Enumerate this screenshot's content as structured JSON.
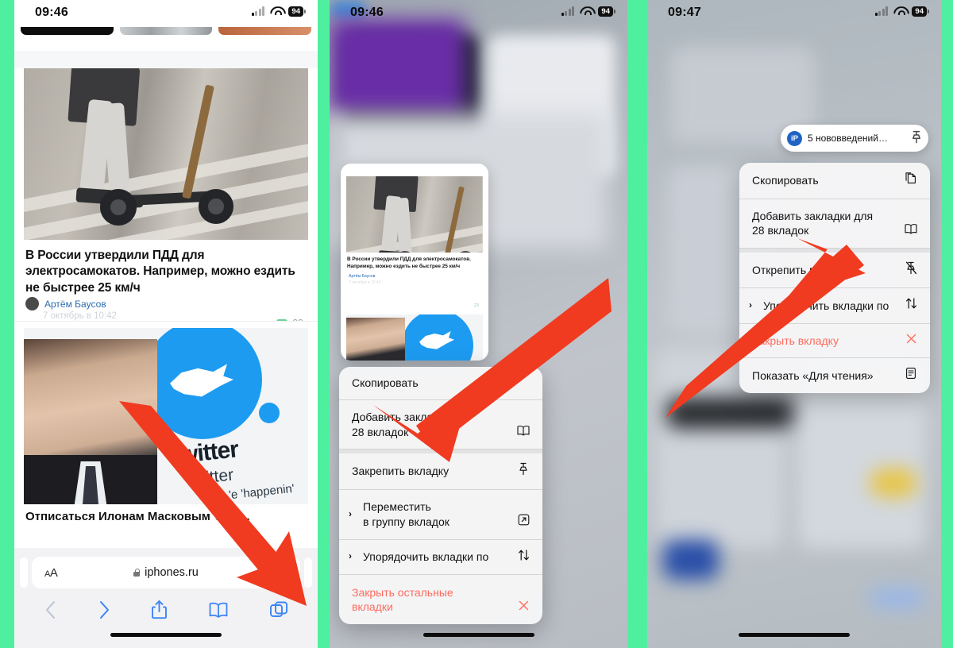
{
  "theme": {
    "accent_green": "#4ef0a0",
    "arrow_red": "#f03b20",
    "link_blue": "#3d84f5",
    "destructive_red": "#ff6b5e"
  },
  "panels": [
    {
      "id": "panel-1-safari-page",
      "status_bar": {
        "time": "09:46",
        "battery": "94",
        "signal_icon": "cellular-signal-icon",
        "wifi_icon": "wifi-icon",
        "battery_icon": "battery-icon"
      },
      "articles": [
        {
          "title": "В России утвердили ПДД для электросамокатов. Например, можно ездить не быстрее 25 км/ч",
          "author": "Артём Баусов",
          "date": "7 октябрь в 10:42",
          "comments": "23",
          "image_name": "electric-scooter-photo"
        },
        {
          "title": "Отписаться Илонам Масковым Твит...",
          "image_name": "elon-musk-twitter-photo",
          "overlay_words": {
            "big": "witter",
            "mid": "witter",
            "small": "'e 'happenin'"
          }
        }
      ],
      "browser_bar": {
        "text_size_label": "AA",
        "url": "iphones.ru",
        "lock_icon": "lock-icon",
        "reload_icon": "reload-icon",
        "back_icon": "chevron-left-icon",
        "forward_icon": "chevron-right-icon",
        "share_icon": "share-icon",
        "bookmarks_icon": "book-icon",
        "tabs_icon": "tabs-icon"
      }
    },
    {
      "id": "panel-2-tab-switcher",
      "status_bar": {
        "time": "09:46",
        "battery": "94"
      },
      "tab_preview": {
        "title": "В России утвердили ПДД для электросамокатов. Например, можно ездить не быстрее 25 км/ч",
        "author": "Артём Баусов",
        "date": "7 октября в 10:42",
        "comments": "23"
      },
      "context_menu": [
        {
          "label": "Скопировать",
          "icon": "copy-icon",
          "icon_glyph": "",
          "chevron": false,
          "destructive": false
        },
        {
          "label": "Добавить закладки\n28 вкладок",
          "icon": "book-icon",
          "icon_glyph": "▯",
          "chevron": false,
          "destructive": false
        },
        {
          "label": "Закрепить вкладку",
          "icon": "pin-icon",
          "icon_glyph": "⚲",
          "chevron": false,
          "destructive": false
        },
        {
          "label": "Переместить\nв группу вкладок",
          "icon": "move-to-group-icon",
          "icon_glyph": "⊡",
          "chevron": true,
          "destructive": false
        },
        {
          "label": "Упорядочить вкладки по",
          "icon": "sort-icon",
          "icon_glyph": "⇅",
          "chevron": true,
          "destructive": false
        },
        {
          "label": "Закрыть остальные\nвкладки",
          "icon": "close-x-icon",
          "icon_glyph": "✕",
          "chevron": false,
          "destructive": true
        }
      ]
    },
    {
      "id": "panel-3-pinned-tab-menu",
      "status_bar": {
        "time": "09:47",
        "battery": "94"
      },
      "pinned_tab": {
        "badge": "iP",
        "title": "5 нововведений…",
        "pin_icon": "pin-icon"
      },
      "context_menu": [
        {
          "label": "Скопировать",
          "icon": "copy-icon",
          "icon_glyph": "⧉",
          "chevron": false,
          "destructive": false
        },
        {
          "label": "Добавить закладки для\n28 вкладок",
          "icon": "book-icon",
          "icon_glyph": "▯",
          "chevron": false,
          "destructive": false
        },
        {
          "label": "Открепить вкладку",
          "icon": "unpin-icon",
          "icon_glyph": "⚲",
          "chevron": false,
          "destructive": false
        },
        {
          "label": "Упорядочить вкладки по",
          "icon": "sort-icon",
          "icon_glyph": "⇅",
          "chevron": true,
          "destructive": false
        },
        {
          "label": "Закрыть вкладку",
          "icon": "close-x-icon",
          "icon_glyph": "✕",
          "chevron": false,
          "destructive": true
        },
        {
          "label": "Показать «Для чтения»",
          "icon": "reader-view-icon",
          "icon_glyph": "🗒",
          "chevron": false,
          "destructive": false
        }
      ]
    }
  ],
  "annotations": [
    {
      "name": "arrow-to-tabs-button",
      "from": "article-area",
      "to": "tabs-button"
    },
    {
      "name": "arrow-to-pin-tab-item",
      "from": "upper-right",
      "to": "pin-tab-menu-item"
    },
    {
      "name": "arrow-to-unpin-tab-item",
      "from": "lower-left",
      "to": "unpin-tab-menu-item"
    }
  ]
}
